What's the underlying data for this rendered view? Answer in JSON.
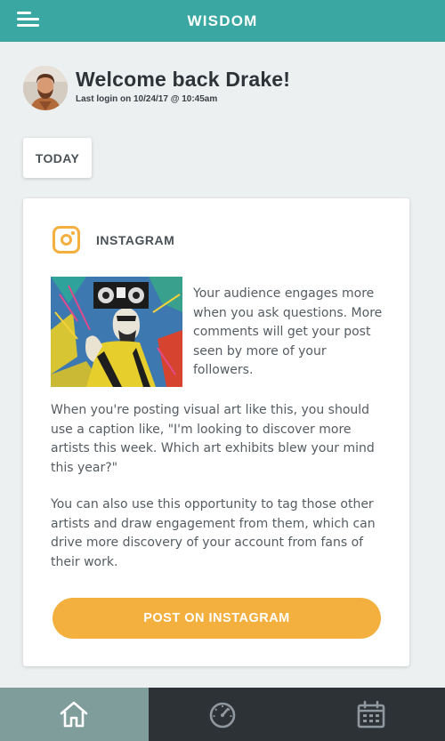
{
  "app": {
    "title": "WISDOM"
  },
  "header": {
    "welcome": "Welcome back Drake!",
    "last_login": "Last login on 10/24/17 @ 10:45am"
  },
  "filter": {
    "today_label": "TODAY"
  },
  "card": {
    "network": "INSTAGRAM",
    "network_icon": "instagram-icon",
    "tip_side": "Your audience engages more when you ask questions. More comments will get your post seen by more of your followers.",
    "tip_caption": "When you're posting visual art like this, you should use a caption like, \"I'm looking to discover more artists this week. Which art exhibits blew your mind this year?\"",
    "tip_tag": "You can also use this opportunity to tag those other artists and draw engagement from them, which can drive more discovery of your account from fans of their work.",
    "cta_label": "POST ON INSTAGRAM"
  },
  "nav": {
    "items": [
      {
        "icon": "home-icon",
        "active": true
      },
      {
        "icon": "speedometer-icon",
        "active": false
      },
      {
        "icon": "calendar-icon",
        "active": false
      }
    ]
  },
  "colors": {
    "brand": "#3aa7a2",
    "accent": "#f3b03f",
    "nav_bg": "#2d3236",
    "nav_active": "#7f9e9b",
    "page_bg": "#edf0f1"
  }
}
